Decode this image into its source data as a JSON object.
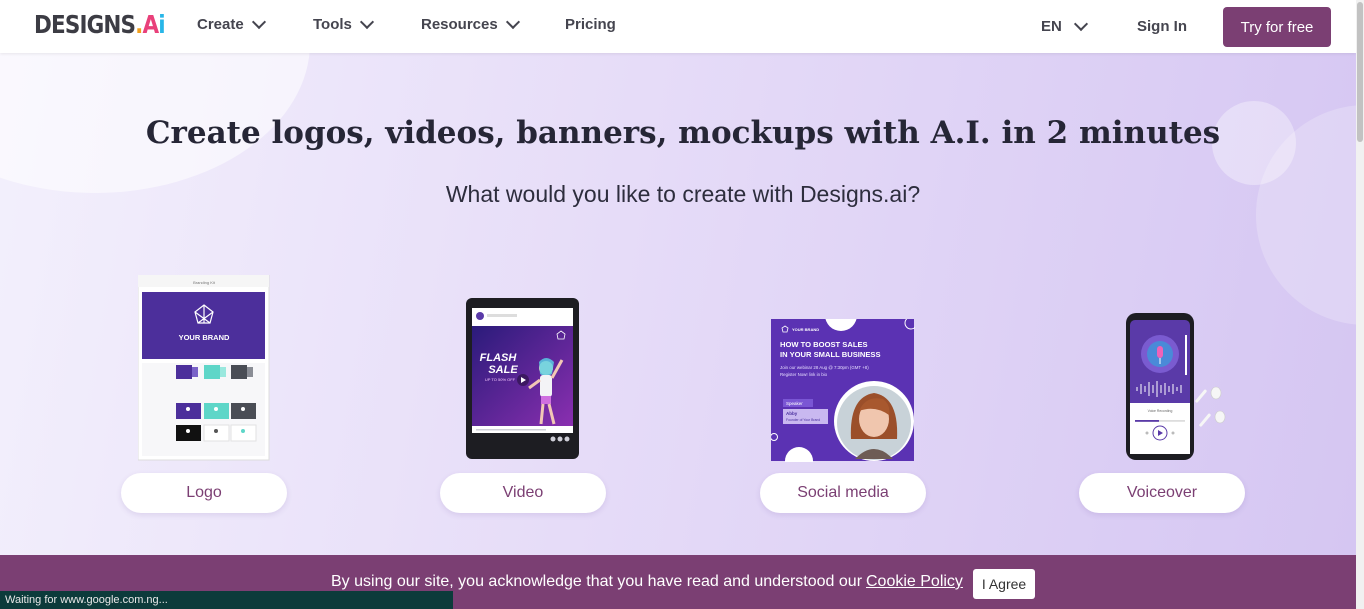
{
  "header": {
    "logo": {
      "main": "DESIGNS",
      "dot": ".",
      "ai_a": "A",
      "ai_i": "i"
    },
    "nav": [
      {
        "label": "Create",
        "has_dropdown": true
      },
      {
        "label": "Tools",
        "has_dropdown": true
      },
      {
        "label": "Resources",
        "has_dropdown": true
      },
      {
        "label": "Pricing",
        "has_dropdown": false
      }
    ],
    "language": "EN",
    "sign_in": "Sign In",
    "try_button": "Try for free"
  },
  "hero": {
    "headline": "Create logos, videos, banners, mockups with A.I. in 2 minutes",
    "subheadline": "What would you like to create with Designs.ai?"
  },
  "cards": [
    {
      "label": "Logo"
    },
    {
      "label": "Video"
    },
    {
      "label": "Social media"
    },
    {
      "label": "Voiceover"
    }
  ],
  "logo_mockup": {
    "title": "Branding Kit",
    "brand": "YOUR BRAND"
  },
  "video_mockup": {
    "line1": "FLASH",
    "line2": "SALE",
    "offer": "UP TO 50% OFF"
  },
  "social_mockup": {
    "brand": "YOUR BRAND",
    "headline1": "HOW TO BOOST SALES",
    "headline2": "IN YOUR SMALL BUSINESS",
    "body1": "Join our webinar 28 Aug @ 7:30pm (GMT +8)",
    "body2": "Register Now! link in bio",
    "speaker_label": "Speaker",
    "speaker_name": "Abby",
    "speaker_role": "Founder of Your Brand"
  },
  "voice_mockup": {
    "status": "Voice Recording"
  },
  "cookie": {
    "text": "By using our site, you acknowledge that you have read and understood our",
    "link": "Cookie Policy",
    "button": "I Agree"
  },
  "browser_status": "Waiting for www.google.com.ng...",
  "colors": {
    "brand_purple": "#7b3f73",
    "hero_purple": "#4a2f9e",
    "cookie_bg": "#7b3f73"
  }
}
